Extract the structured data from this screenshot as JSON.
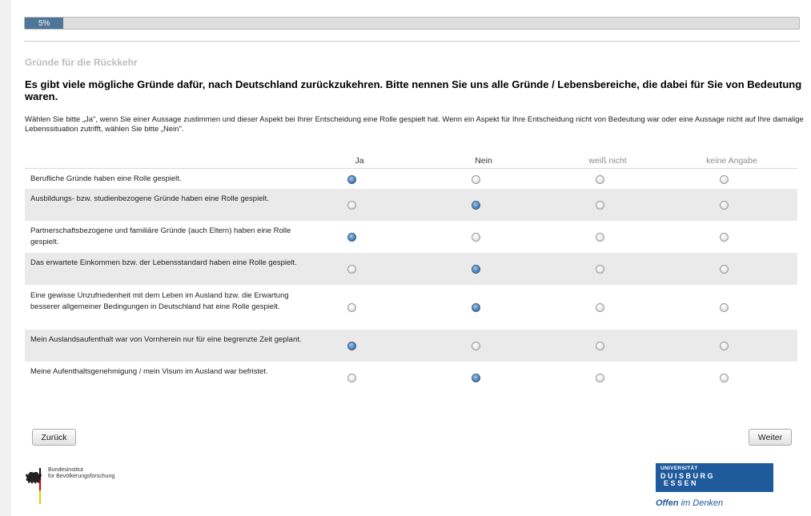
{
  "progress": {
    "percent_label": "5%",
    "fraction": 0.05
  },
  "section_title": "Gründe für die Rückkehr",
  "question": "Es gibt viele mögliche Gründe dafür, nach Deutschland zurückzukehren. Bitte nennen Sie uns alle Gründe / Lebensbereiche, die dabei für Sie von Bedeutung waren.",
  "instruction": "Wählen Sie bitte „Ja\", wenn Sie einer Aussage zustimmen und dieser Aspekt bei Ihrer Entscheidung eine Rolle gespielt hat. Wenn ein Aspekt für Ihre Entscheidung nicht von Bedeutung war oder eine Aussage nicht auf Ihre damalige Lebenssituation zutrifft, wählen Sie bitte „Nein\".",
  "columns": [
    "Ja",
    "Nein",
    "weiß nicht",
    "keine Angabe"
  ],
  "rows": [
    {
      "label": "Berufliche Gründe haben eine Rolle gespielt.",
      "selected": "Ja"
    },
    {
      "label": "Ausbildungs- bzw. studienbezogene Gründe haben eine Rolle gespielt.",
      "selected": "Nein"
    },
    {
      "label": "Partnerschaftsbezogene und familiäre Gründe (auch Eltern) haben eine Rolle gespielt.",
      "selected": "Ja"
    },
    {
      "label": "Das erwartete Einkommen bzw. der Lebensstandard haben eine Rolle gespielt.",
      "selected": "Nein"
    },
    {
      "label": "Eine gewisse Unzufriedenheit mit dem Leben im Ausland bzw. die Erwartung besserer allgemeiner Bedingungen in Deutschland hat eine Rolle gespielt.",
      "selected": "Nein"
    },
    {
      "label": "Mein Auslandsaufenthalt war von Vornherein nur für eine begrenzte Zeit geplant.",
      "selected": "Ja"
    },
    {
      "label": "Meine Aufenthaltsgenehmigung / mein Visum im Ausland war befristet.",
      "selected": "Nein"
    }
  ],
  "buttons": {
    "back": "Zurück",
    "next": "Weiter"
  },
  "footer": {
    "bib_line1": "Bundesinstitut",
    "bib_line2": "für Bevölkerungsforschung",
    "ude_line1": "UNIVERSITÄT",
    "ude_line2": "DUISBURG",
    "ude_line3": "ESSEN",
    "ude_slogan_1": "Offen",
    "ude_slogan_2": "im Denken"
  },
  "colors": {
    "progress": "#4f7599",
    "ude_blue": "#1f5b9c",
    "radio_checked": "#4f86c0"
  }
}
